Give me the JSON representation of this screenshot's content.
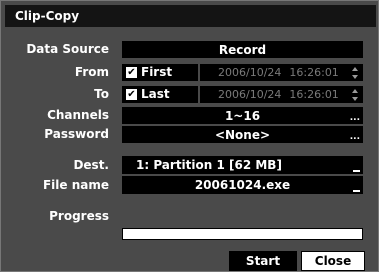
{
  "dialog": {
    "title": "Clip-Copy"
  },
  "labels": {
    "data_source": "Data Source",
    "from": "From",
    "to": "To",
    "channels": "Channels",
    "password": "Password",
    "dest": "Dest.",
    "file_name": "File name",
    "progress": "Progress"
  },
  "fields": {
    "data_source": "Record",
    "from_check_label": "First",
    "from_date": "2006/10/24",
    "from_time": "16:26:01",
    "to_check_label": "Last",
    "to_date": "2006/10/24",
    "to_time": "16:26:01",
    "channels": "1~16",
    "password": "<None>",
    "dest": "1: Partition 1 [62 MB]",
    "file_name": "20061024.exe",
    "ellipsis": "..."
  },
  "checkboxes": {
    "from_first": true,
    "to_last": true,
    "mark": "✔"
  },
  "progress": {
    "value": 0
  },
  "buttons": {
    "start": "Start",
    "close": "Close"
  }
}
